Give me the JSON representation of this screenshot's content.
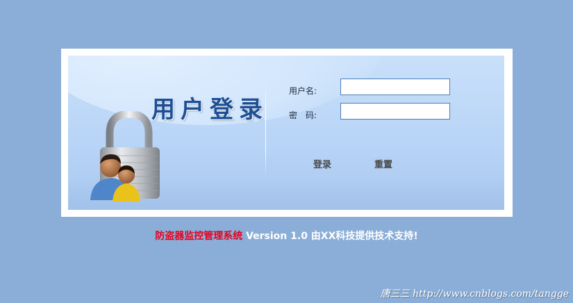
{
  "login_panel": {
    "title": "用户登录",
    "username_label": "用户名:",
    "username_value": "",
    "password_label": "密　码:",
    "password_value": "",
    "login_button": "登录",
    "reset_button": "重置"
  },
  "footer": {
    "system_name": "防盗器监控管理系统",
    "support_text": " Version 1.0 由XX科技提供技术支持!"
  },
  "watermark": "唐三三 http://www.cnblogs.com/tangge",
  "colors": {
    "background": "#8aaed8",
    "title": "#1d4f96",
    "system_name": "#e8001c"
  },
  "icons": [
    "padlock-users-icon"
  ]
}
